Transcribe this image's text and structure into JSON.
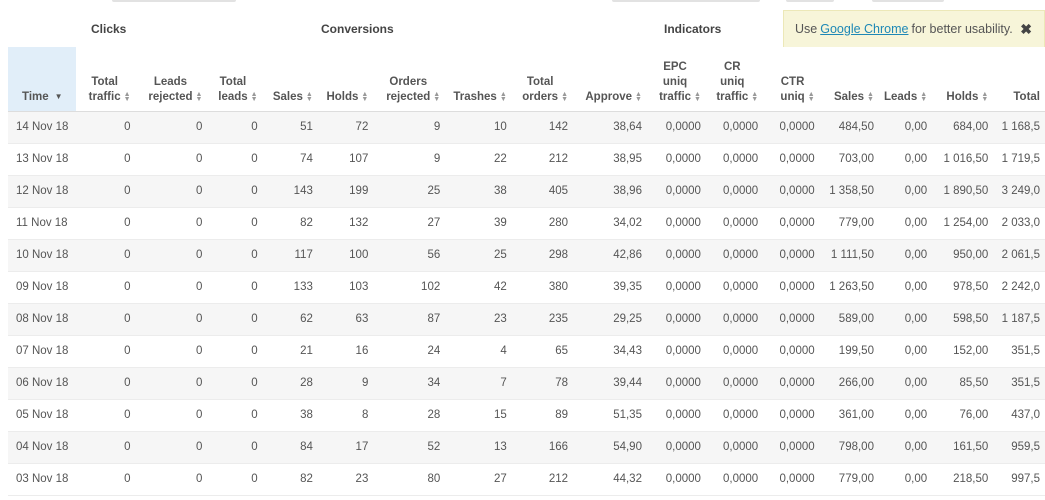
{
  "notice": {
    "prefix": "Use",
    "link": "Google Chrome",
    "suffix": "for better usability.",
    "close": "✖"
  },
  "groups": {
    "clicks": "Clicks",
    "conversions": "Conversions",
    "indicators": "Indicators"
  },
  "columns": [
    {
      "l1": "",
      "l2": "Time",
      "sort": "desc"
    },
    {
      "l1": "Total",
      "l2": "traffic",
      "sort": "both"
    },
    {
      "l1": "Leads",
      "l2": "rejected",
      "sort": "both"
    },
    {
      "l1": "Total",
      "l2": "leads",
      "sort": "both"
    },
    {
      "l1": "",
      "l2": "Sales",
      "sort": "both"
    },
    {
      "l1": "",
      "l2": "Holds",
      "sort": "both"
    },
    {
      "l1": "Orders",
      "l2": "rejected",
      "sort": "both"
    },
    {
      "l1": "",
      "l2": "Trashes",
      "sort": "both"
    },
    {
      "l1": "Total",
      "l2": "orders",
      "sort": "both"
    },
    {
      "l1": "",
      "l2": "Approve",
      "sort": "both"
    },
    {
      "l0": "EPC",
      "l1": "uniq",
      "l2": "traffic",
      "sort": "both"
    },
    {
      "l0": "CR",
      "l1": "uniq",
      "l2": "traffic",
      "sort": "both"
    },
    {
      "l0": "",
      "l1": "CTR",
      "l2": "uniq",
      "sort": "both"
    },
    {
      "l1": "",
      "l2": "Sales",
      "sort": "both"
    },
    {
      "l1": "",
      "l2": "Leads",
      "sort": "both"
    },
    {
      "l1": "",
      "l2": "Holds",
      "sort": "both"
    },
    {
      "l1": "",
      "l2": "Total",
      "sort": "none"
    }
  ],
  "rows": [
    [
      "14 Nov 18",
      "0",
      "0",
      "0",
      "51",
      "72",
      "9",
      "10",
      "142",
      "38,64",
      "0,0000",
      "0,0000",
      "0,0000",
      "484,50",
      "0,00",
      "684,00",
      "1 168,5"
    ],
    [
      "13 Nov 18",
      "0",
      "0",
      "0",
      "74",
      "107",
      "9",
      "22",
      "212",
      "38,95",
      "0,0000",
      "0,0000",
      "0,0000",
      "703,00",
      "0,00",
      "1 016,50",
      "1 719,5"
    ],
    [
      "12 Nov 18",
      "0",
      "0",
      "0",
      "143",
      "199",
      "25",
      "38",
      "405",
      "38,96",
      "0,0000",
      "0,0000",
      "0,0000",
      "1 358,50",
      "0,00",
      "1 890,50",
      "3 249,0"
    ],
    [
      "11 Nov 18",
      "0",
      "0",
      "0",
      "82",
      "132",
      "27",
      "39",
      "280",
      "34,02",
      "0,0000",
      "0,0000",
      "0,0000",
      "779,00",
      "0,00",
      "1 254,00",
      "2 033,0"
    ],
    [
      "10 Nov 18",
      "0",
      "0",
      "0",
      "117",
      "100",
      "56",
      "25",
      "298",
      "42,86",
      "0,0000",
      "0,0000",
      "0,0000",
      "1 111,50",
      "0,00",
      "950,00",
      "2 061,5"
    ],
    [
      "09 Nov 18",
      "0",
      "0",
      "0",
      "133",
      "103",
      "102",
      "42",
      "380",
      "39,35",
      "0,0000",
      "0,0000",
      "0,0000",
      "1 263,50",
      "0,00",
      "978,50",
      "2 242,0"
    ],
    [
      "08 Nov 18",
      "0",
      "0",
      "0",
      "62",
      "63",
      "87",
      "23",
      "235",
      "29,25",
      "0,0000",
      "0,0000",
      "0,0000",
      "589,00",
      "0,00",
      "598,50",
      "1 187,5"
    ],
    [
      "07 Nov 18",
      "0",
      "0",
      "0",
      "21",
      "16",
      "24",
      "4",
      "65",
      "34,43",
      "0,0000",
      "0,0000",
      "0,0000",
      "199,50",
      "0,00",
      "152,00",
      "351,5"
    ],
    [
      "06 Nov 18",
      "0",
      "0",
      "0",
      "28",
      "9",
      "34",
      "7",
      "78",
      "39,44",
      "0,0000",
      "0,0000",
      "0,0000",
      "266,00",
      "0,00",
      "85,50",
      "351,5"
    ],
    [
      "05 Nov 18",
      "0",
      "0",
      "0",
      "38",
      "8",
      "28",
      "15",
      "89",
      "51,35",
      "0,0000",
      "0,0000",
      "0,0000",
      "361,00",
      "0,00",
      "76,00",
      "437,0"
    ],
    [
      "04 Nov 18",
      "0",
      "0",
      "0",
      "84",
      "17",
      "52",
      "13",
      "166",
      "54,90",
      "0,0000",
      "0,0000",
      "0,0000",
      "798,00",
      "0,00",
      "161,50",
      "959,5"
    ],
    [
      "03 Nov 18",
      "0",
      "0",
      "0",
      "82",
      "23",
      "80",
      "27",
      "212",
      "44,32",
      "0,0000",
      "0,0000",
      "0,0000",
      "779,00",
      "0,00",
      "218,50",
      "997,5"
    ]
  ]
}
